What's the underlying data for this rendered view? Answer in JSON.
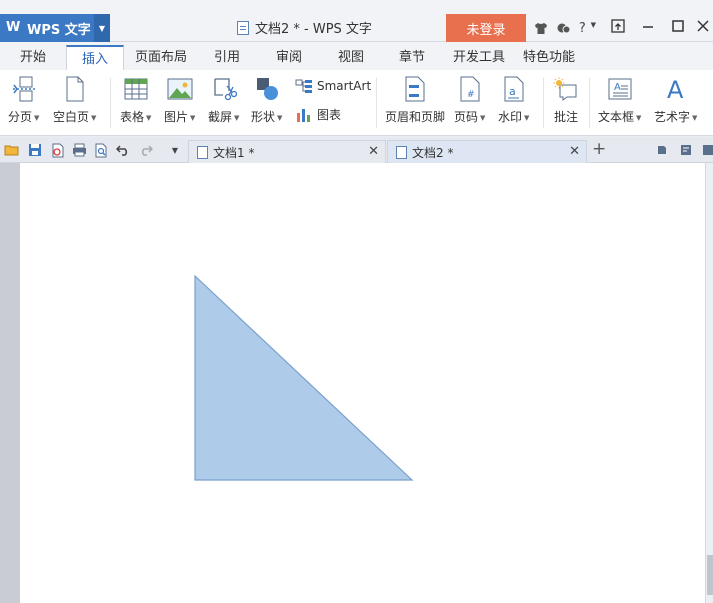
{
  "titlebar": {
    "app_button": "WPS 文字",
    "document_title": "文档2 * - WPS 文字",
    "login_button": "未登录",
    "help_label": "?"
  },
  "menu": {
    "tabs": [
      "开始",
      "插入",
      "页面布局",
      "引用",
      "审阅",
      "视图",
      "章节",
      "开发工具",
      "特色功能"
    ],
    "active_tab": "插入"
  },
  "ribbon": {
    "page_break": "分页",
    "blank_page": "空白页",
    "table": "表格",
    "picture": "图片",
    "screenshot": "截屏",
    "shape": "形状",
    "smartart": "SmartArt",
    "chart": "图表",
    "header_footer": "页眉和页脚",
    "page_number": "页码",
    "watermark": "水印",
    "comment": "批注",
    "text_box": "文本框",
    "word_art": "艺术字"
  },
  "doc_tabs": [
    {
      "label": "文档1 *",
      "active": false
    },
    {
      "label": "文档2 *",
      "active": true
    }
  ],
  "shape": {
    "type": "right-triangle",
    "fill": "#aecbe9",
    "stroke": "#7aa0cc"
  },
  "colors": {
    "app_blue": "#3b79c4",
    "login_orange": "#e8704e"
  }
}
